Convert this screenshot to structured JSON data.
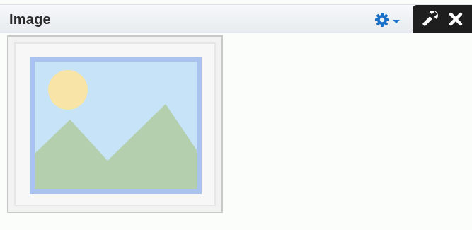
{
  "panel": {
    "title": "Image"
  },
  "toolbar": {
    "gear_icon": "gear-icon",
    "dropdown_icon": "caret-down-icon",
    "wrench_icon": "wrench-icon",
    "close_icon": "close-icon"
  },
  "colors": {
    "gear": "#1a6fc9",
    "edit_bar_bg": "#1e1e1e",
    "placeholder_sky": "#c7e3f7",
    "placeholder_sun": "#f7e4a6",
    "placeholder_mountains": "#b4cfad",
    "placeholder_border": "#a9c3ee"
  },
  "content": {
    "image_placeholder_icon": "image-placeholder-icon"
  }
}
